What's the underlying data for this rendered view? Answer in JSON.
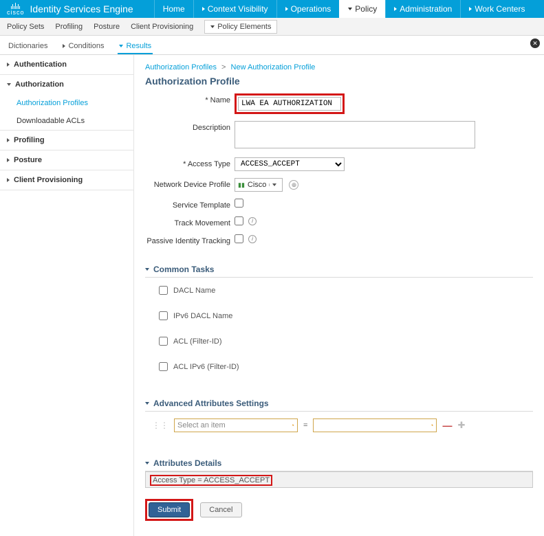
{
  "header": {
    "product": "Identity Services Engine",
    "brand": "cisco",
    "nav": [
      {
        "label": "Home"
      },
      {
        "label": "Context Visibility"
      },
      {
        "label": "Operations"
      },
      {
        "label": "Policy"
      },
      {
        "label": "Administration"
      },
      {
        "label": "Work Centers"
      }
    ]
  },
  "subnav": {
    "items": [
      {
        "label": "Policy Sets"
      },
      {
        "label": "Profiling"
      },
      {
        "label": "Posture"
      },
      {
        "label": "Client Provisioning"
      },
      {
        "label": "Policy Elements"
      }
    ]
  },
  "tabs": {
    "items": [
      {
        "label": "Dictionaries"
      },
      {
        "label": "Conditions"
      },
      {
        "label": "Results"
      }
    ]
  },
  "sidebar": {
    "groups": [
      {
        "title": "Authentication",
        "items": []
      },
      {
        "title": "Authorization",
        "items": [
          "Authorization Profiles",
          "Downloadable ACLs"
        ]
      },
      {
        "title": "Profiling",
        "items": []
      },
      {
        "title": "Posture",
        "items": []
      },
      {
        "title": "Client Provisioning",
        "items": []
      }
    ]
  },
  "breadcrumb": {
    "root": "Authorization Profiles",
    "current": "New Authorization Profile"
  },
  "page": {
    "title": "Authorization Profile"
  },
  "form": {
    "name_label": "* Name",
    "name_value": "LWA EA AUTHORIZATION",
    "description_label": "Description",
    "description_value": "",
    "access_type_label": "* Access Type",
    "access_type_value": "ACCESS_ACCEPT",
    "ndp_label": "Network Device Profile",
    "ndp_value": "Cisco",
    "service_template_label": "Service Template",
    "track_movement_label": "Track Movement",
    "passive_identity_label": "Passive Identity Tracking"
  },
  "common_tasks": {
    "title": "Common Tasks",
    "items": [
      {
        "label": "DACL Name"
      },
      {
        "label": "IPv6 DACL Name"
      },
      {
        "label": "ACL  (Filter-ID)"
      },
      {
        "label": "ACL IPv6  (Filter-ID)"
      }
    ]
  },
  "advanced": {
    "title": "Advanced Attributes Settings",
    "placeholder": "Select an item",
    "op": "="
  },
  "attributes": {
    "title": "Attributes Details",
    "text": "Access Type = ACCESS_ACCEPT"
  },
  "buttons": {
    "submit": "Submit",
    "cancel": "Cancel"
  }
}
